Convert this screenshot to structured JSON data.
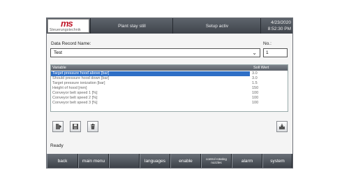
{
  "header": {
    "logo_text": "ms",
    "logo_sub": "Steuerungstechnik",
    "status_left": "Plant stay still",
    "status_right": "Setup activ",
    "date": "4/23/2020",
    "time": "8:52:30 PM"
  },
  "form": {
    "record_label": "Data Record Name:",
    "record_value": "Test",
    "no_label": "No.:",
    "no_value": "1"
  },
  "table": {
    "headers": [
      "Variable",
      "Soll Wert"
    ],
    "rows": [
      {
        "name": "Target pressure hood above [bar]",
        "value": "3.0"
      },
      {
        "name": "Should pressure hood down [bar]",
        "value": "3.0"
      },
      {
        "name": "Target pressure ionization [bar]",
        "value": "1.5"
      },
      {
        "name": "Height of hood [mm]",
        "value": "150"
      },
      {
        "name": "Conveyor belt speed 1 [%]",
        "value": "100"
      },
      {
        "name": "Conveyor belt speed 2 [%]",
        "value": "100"
      },
      {
        "name": "Conveyor belt speed 3 [%]",
        "value": "100"
      }
    ]
  },
  "status": "Ready",
  "nav": {
    "back": "back",
    "main_menu": "main menu",
    "blank": "",
    "languages": "languages",
    "enable": "enable",
    "control": "control rotating nozzles",
    "alarm": "alarm",
    "system": "system"
  },
  "icons": [
    "new-record-icon",
    "save-icon",
    "delete-icon",
    "import-icon"
  ]
}
